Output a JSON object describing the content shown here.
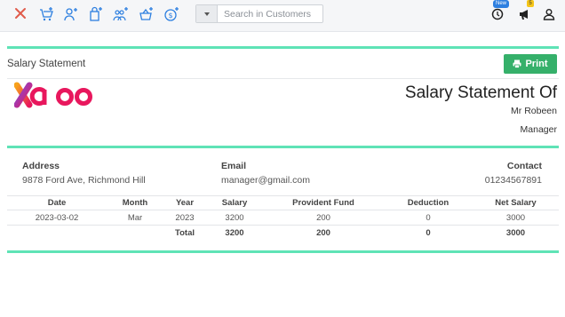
{
  "toolbar": {
    "search_placeholder": "Search in Customers",
    "new_badge": "New",
    "notif_count": "5",
    "colors": {
      "close": "#e05b4b",
      "icons": "#2d7fe0"
    }
  },
  "panel": {
    "title": "Salary Statement",
    "print_label": "Print"
  },
  "statement": {
    "heading": "Salary Statement Of",
    "employee_name": "Mr Robeen",
    "position": "Manager"
  },
  "info": {
    "address_label": "Address",
    "address_value": "9878 Ford Ave, Richmond Hill",
    "email_label": "Email",
    "email_value": "manager@gmail.com",
    "contact_label": "Contact",
    "contact_value": "01234567891"
  },
  "table": {
    "headers": [
      "Date",
      "Month",
      "Year",
      "Salary",
      "Provident Fund",
      "Deduction",
      "Net Salary"
    ],
    "rows": [
      [
        "2023-03-02",
        "Mar",
        "2023",
        "3200",
        "200",
        "0",
        "3000"
      ]
    ],
    "total": {
      "label": "Total",
      "salary": "3200",
      "provident_fund": "200",
      "deduction": "0",
      "net_salary": "3000"
    }
  }
}
